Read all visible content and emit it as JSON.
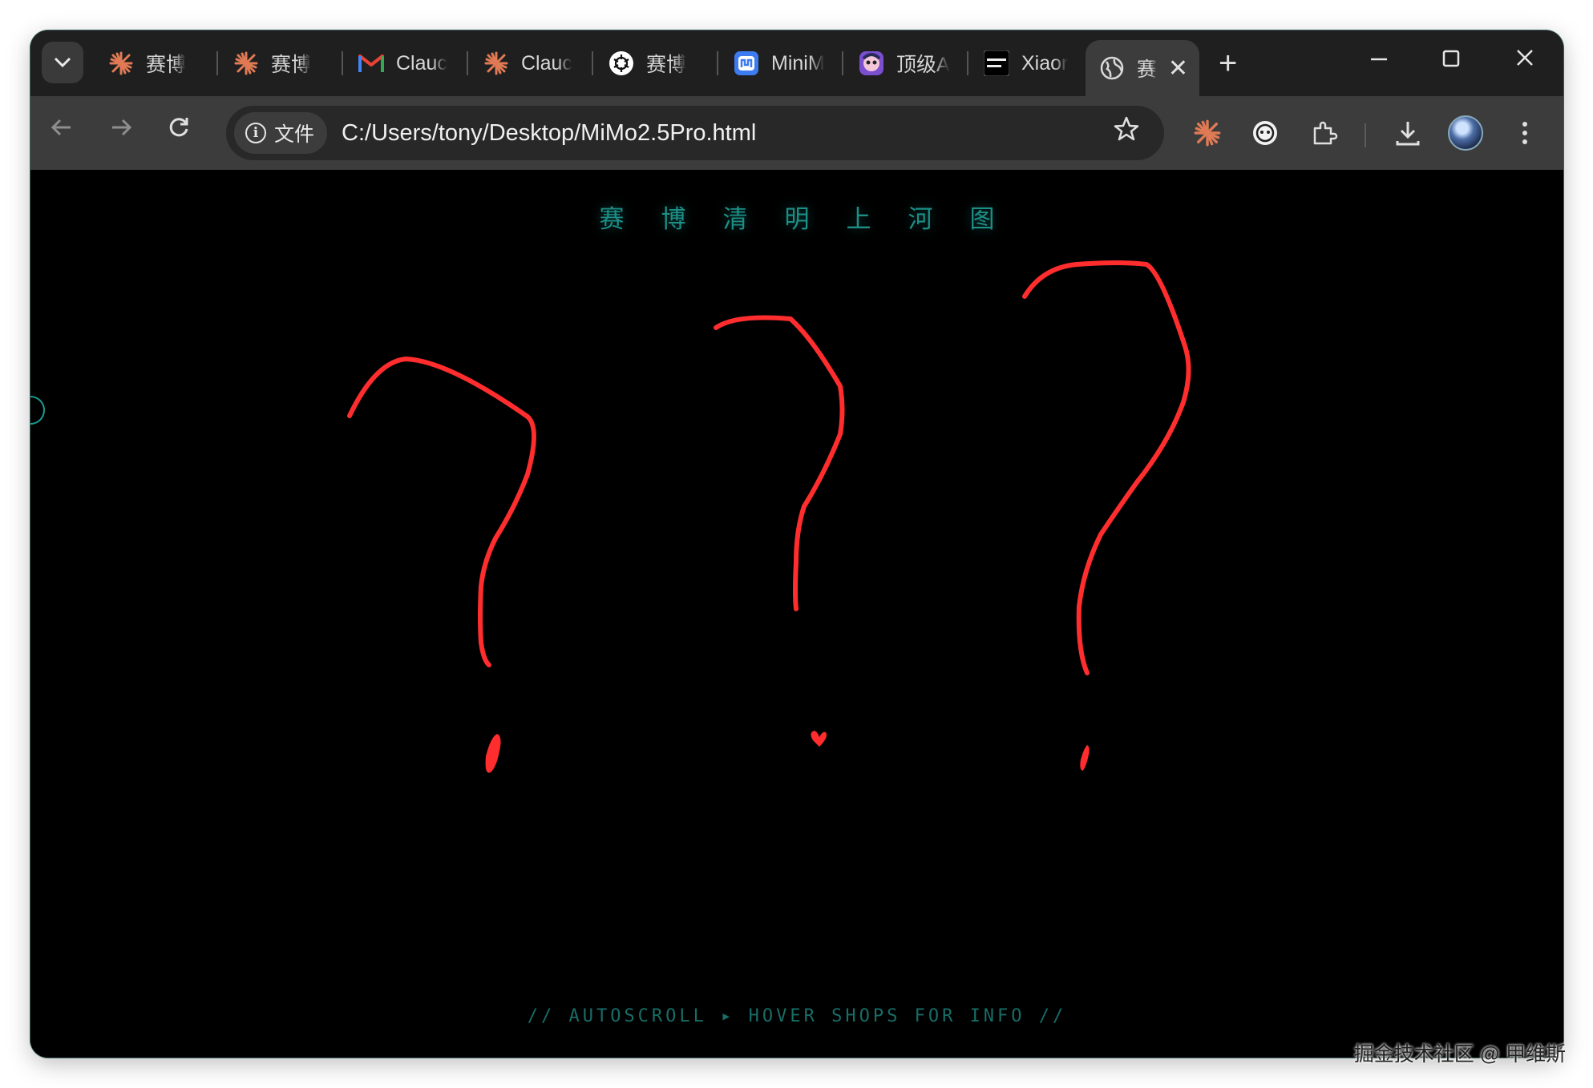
{
  "browser": {
    "tabs": [
      {
        "label": "赛博",
        "icon": "claude-sparkle-icon"
      },
      {
        "label": "赛博",
        "icon": "claude-sparkle-icon"
      },
      {
        "label": "Clauc",
        "icon": "gmail-icon"
      },
      {
        "label": "Clauc",
        "icon": "claude-sparkle-icon"
      },
      {
        "label": "赛博",
        "icon": "openai-icon"
      },
      {
        "label": "MiniM",
        "icon": "minimax-icon"
      },
      {
        "label": "顶级A",
        "icon": "avatar-app-icon"
      },
      {
        "label": "Xiaor",
        "icon": "xiaomi-mimo-icon"
      }
    ],
    "active_tab": {
      "label": "赛",
      "icon": "globe-icon",
      "close": "✕"
    },
    "new_tab": "+",
    "window_controls": {
      "minimize": "—",
      "maximize": "☐",
      "close": "✕"
    },
    "omnibox": {
      "chip_label": "文件",
      "url": "C:/Users/tony/Desktop/MiMo2.5Pro.html"
    }
  },
  "page": {
    "title": "赛博清明上河图",
    "footer_hint": "// AUTOSCROLL ▸ HOVER SHOPS FOR INFO //",
    "annotation_color": "#ff2d2d",
    "accent_color": "#1c8f86"
  },
  "watermark": "掘金技术社区 @ 甲维斯"
}
